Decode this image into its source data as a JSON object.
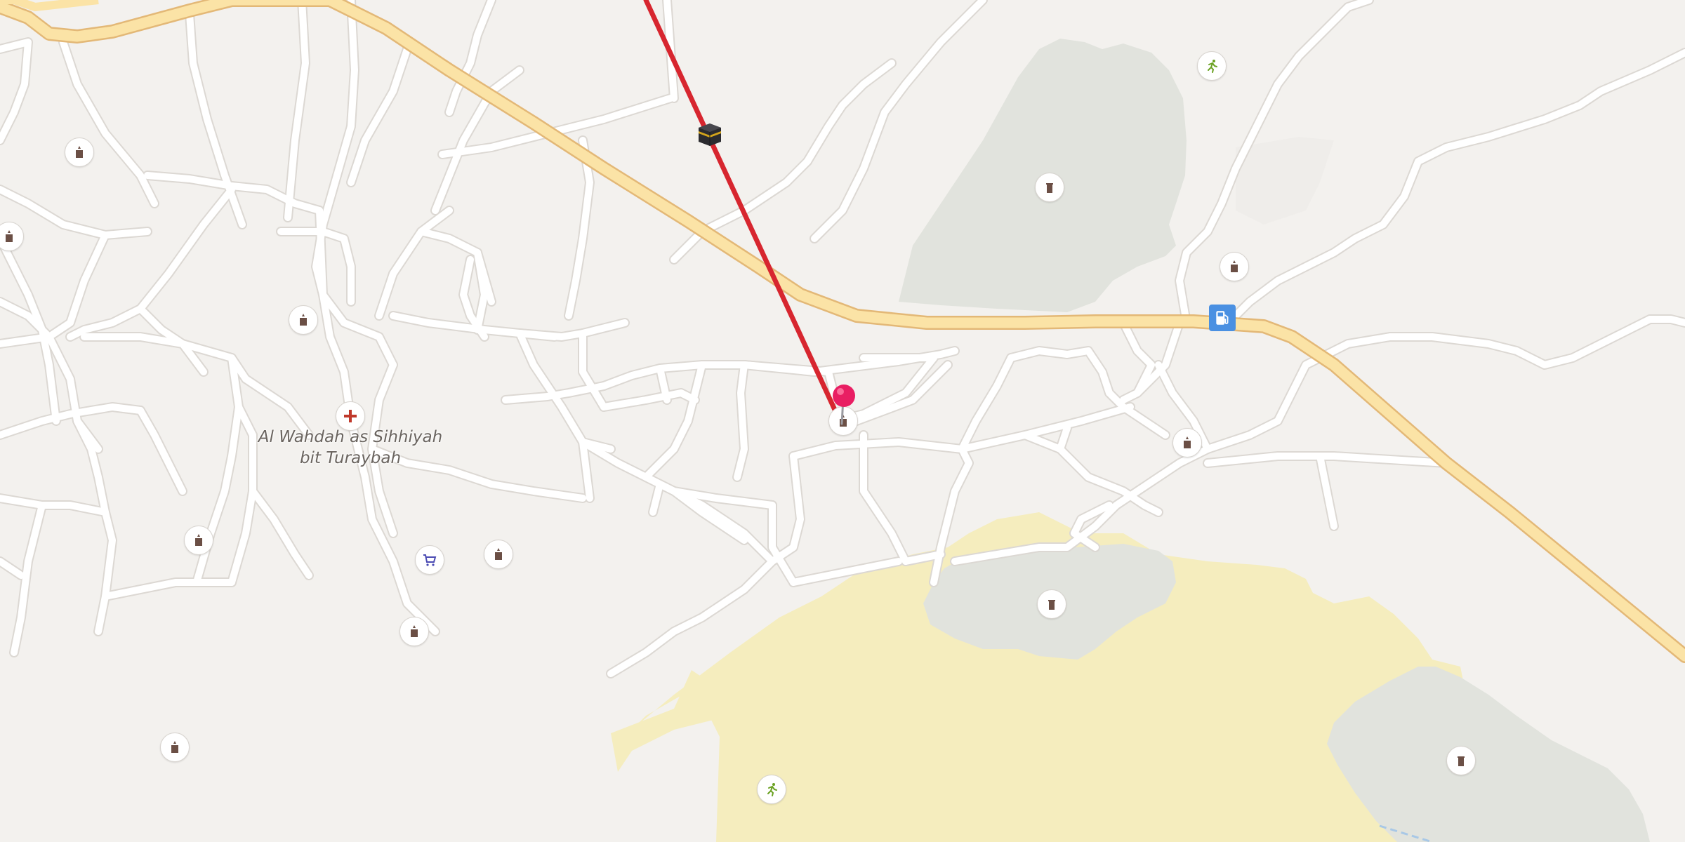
{
  "map": {
    "labels": {
      "place_label": "Al Wahdah as Sihhiyah bit Turaybah"
    },
    "place_label_lines": [
      "Al Wahdah as Sihhiyah",
      "bit Turaybah"
    ],
    "icons": {
      "mosque": "mosque-icon",
      "cemetery": "cemetery-icon",
      "hospital": "hospital-icon",
      "shop": "shopping-cart-icon",
      "fuel": "fuel-station-icon",
      "sports": "sports-runner-icon",
      "kaaba": "kaaba-icon",
      "pin": "location-pin-icon"
    },
    "colors": {
      "background": "#f3f1ee",
      "major_road": "#fbe3a6",
      "major_road_casing": "#e3b877",
      "cemetery_area": "#e1e3dd",
      "sand_area": "#f5edbe",
      "route_line": "#d7262f",
      "pin": "#e91e63",
      "fuel_badge": "#4a90e2",
      "hospital_cross": "#c0392b",
      "shop_cart": "#4b4bb3",
      "sports_icon": "#6aa121",
      "icon_brown": "#6b4f45"
    }
  }
}
